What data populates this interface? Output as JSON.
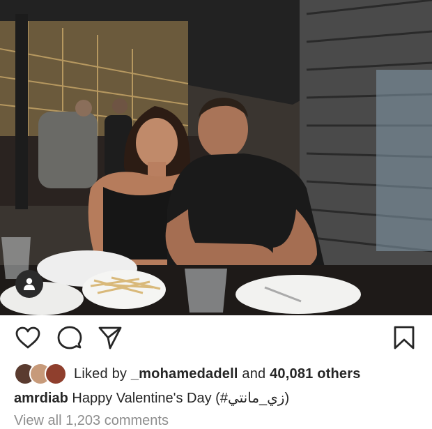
{
  "post": {
    "photo_icon": "photo-of-couple-at-restaurant",
    "tag_icon": "user-tag-icon"
  },
  "actions": {
    "like_icon": "heart-icon",
    "comment_icon": "comment-icon",
    "share_icon": "paper-plane-icon",
    "save_icon": "bookmark-icon"
  },
  "likes": {
    "prefix": "Liked by ",
    "user": "_mohamedadell",
    "middle": " and ",
    "count": "40,081 others",
    "avatar_colors": [
      "#5a3b2f",
      "#c79a7a",
      "#8f3f2d"
    ]
  },
  "caption": {
    "username": "amrdiab",
    "text": "Happy Valentine's Day (#زي_مانتي)"
  },
  "comments": {
    "link_text": "View all 1,203 comments"
  }
}
